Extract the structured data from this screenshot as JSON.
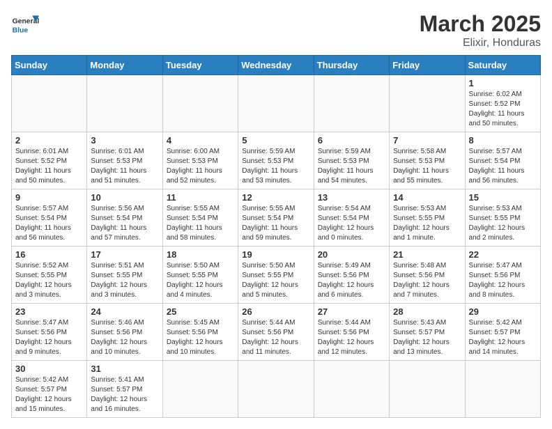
{
  "header": {
    "logo_general": "General",
    "logo_blue": "Blue",
    "title": "March 2025",
    "subtitle": "Elixir, Honduras"
  },
  "days_of_week": [
    "Sunday",
    "Monday",
    "Tuesday",
    "Wednesday",
    "Thursday",
    "Friday",
    "Saturday"
  ],
  "weeks": [
    [
      {
        "day": "",
        "info": ""
      },
      {
        "day": "",
        "info": ""
      },
      {
        "day": "",
        "info": ""
      },
      {
        "day": "",
        "info": ""
      },
      {
        "day": "",
        "info": ""
      },
      {
        "day": "",
        "info": ""
      },
      {
        "day": "1",
        "info": "Sunrise: 6:02 AM\nSunset: 5:52 PM\nDaylight: 11 hours and 50 minutes."
      }
    ],
    [
      {
        "day": "2",
        "info": "Sunrise: 6:01 AM\nSunset: 5:52 PM\nDaylight: 11 hours and 50 minutes."
      },
      {
        "day": "3",
        "info": "Sunrise: 6:01 AM\nSunset: 5:53 PM\nDaylight: 11 hours and 51 minutes."
      },
      {
        "day": "4",
        "info": "Sunrise: 6:00 AM\nSunset: 5:53 PM\nDaylight: 11 hours and 52 minutes."
      },
      {
        "day": "5",
        "info": "Sunrise: 5:59 AM\nSunset: 5:53 PM\nDaylight: 11 hours and 53 minutes."
      },
      {
        "day": "6",
        "info": "Sunrise: 5:59 AM\nSunset: 5:53 PM\nDaylight: 11 hours and 54 minutes."
      },
      {
        "day": "7",
        "info": "Sunrise: 5:58 AM\nSunset: 5:53 PM\nDaylight: 11 hours and 55 minutes."
      },
      {
        "day": "8",
        "info": "Sunrise: 5:57 AM\nSunset: 5:54 PM\nDaylight: 11 hours and 56 minutes."
      }
    ],
    [
      {
        "day": "9",
        "info": "Sunrise: 5:57 AM\nSunset: 5:54 PM\nDaylight: 11 hours and 56 minutes."
      },
      {
        "day": "10",
        "info": "Sunrise: 5:56 AM\nSunset: 5:54 PM\nDaylight: 11 hours and 57 minutes."
      },
      {
        "day": "11",
        "info": "Sunrise: 5:55 AM\nSunset: 5:54 PM\nDaylight: 11 hours and 58 minutes."
      },
      {
        "day": "12",
        "info": "Sunrise: 5:55 AM\nSunset: 5:54 PM\nDaylight: 11 hours and 59 minutes."
      },
      {
        "day": "13",
        "info": "Sunrise: 5:54 AM\nSunset: 5:54 PM\nDaylight: 12 hours and 0 minutes."
      },
      {
        "day": "14",
        "info": "Sunrise: 5:53 AM\nSunset: 5:55 PM\nDaylight: 12 hours and 1 minute."
      },
      {
        "day": "15",
        "info": "Sunrise: 5:53 AM\nSunset: 5:55 PM\nDaylight: 12 hours and 2 minutes."
      }
    ],
    [
      {
        "day": "16",
        "info": "Sunrise: 5:52 AM\nSunset: 5:55 PM\nDaylight: 12 hours and 3 minutes."
      },
      {
        "day": "17",
        "info": "Sunrise: 5:51 AM\nSunset: 5:55 PM\nDaylight: 12 hours and 3 minutes."
      },
      {
        "day": "18",
        "info": "Sunrise: 5:50 AM\nSunset: 5:55 PM\nDaylight: 12 hours and 4 minutes."
      },
      {
        "day": "19",
        "info": "Sunrise: 5:50 AM\nSunset: 5:55 PM\nDaylight: 12 hours and 5 minutes."
      },
      {
        "day": "20",
        "info": "Sunrise: 5:49 AM\nSunset: 5:56 PM\nDaylight: 12 hours and 6 minutes."
      },
      {
        "day": "21",
        "info": "Sunrise: 5:48 AM\nSunset: 5:56 PM\nDaylight: 12 hours and 7 minutes."
      },
      {
        "day": "22",
        "info": "Sunrise: 5:47 AM\nSunset: 5:56 PM\nDaylight: 12 hours and 8 minutes."
      }
    ],
    [
      {
        "day": "23",
        "info": "Sunrise: 5:47 AM\nSunset: 5:56 PM\nDaylight: 12 hours and 9 minutes."
      },
      {
        "day": "24",
        "info": "Sunrise: 5:46 AM\nSunset: 5:56 PM\nDaylight: 12 hours and 10 minutes."
      },
      {
        "day": "25",
        "info": "Sunrise: 5:45 AM\nSunset: 5:56 PM\nDaylight: 12 hours and 10 minutes."
      },
      {
        "day": "26",
        "info": "Sunrise: 5:44 AM\nSunset: 5:56 PM\nDaylight: 12 hours and 11 minutes."
      },
      {
        "day": "27",
        "info": "Sunrise: 5:44 AM\nSunset: 5:56 PM\nDaylight: 12 hours and 12 minutes."
      },
      {
        "day": "28",
        "info": "Sunrise: 5:43 AM\nSunset: 5:57 PM\nDaylight: 12 hours and 13 minutes."
      },
      {
        "day": "29",
        "info": "Sunrise: 5:42 AM\nSunset: 5:57 PM\nDaylight: 12 hours and 14 minutes."
      }
    ],
    [
      {
        "day": "30",
        "info": "Sunrise: 5:42 AM\nSunset: 5:57 PM\nDaylight: 12 hours and 15 minutes."
      },
      {
        "day": "31",
        "info": "Sunrise: 5:41 AM\nSunset: 5:57 PM\nDaylight: 12 hours and 16 minutes."
      },
      {
        "day": "",
        "info": ""
      },
      {
        "day": "",
        "info": ""
      },
      {
        "day": "",
        "info": ""
      },
      {
        "day": "",
        "info": ""
      },
      {
        "day": "",
        "info": ""
      }
    ]
  ]
}
